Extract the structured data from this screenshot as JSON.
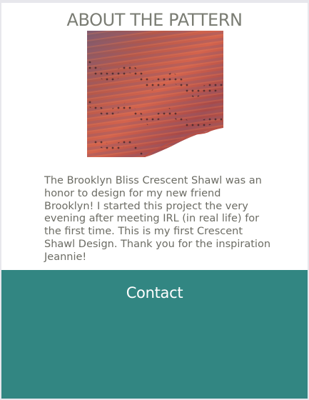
{
  "about": {
    "heading": "ABOUT THE PATTERN",
    "image_subject": "knitted lace crescent shawl in variegated orange, red and purple yarn",
    "description": "The Brooklyn Bliss Crescent Shawl was an honor to design for my new friend Brooklyn! I started this project the very evening after meeting IRL (in real life) for the first time. This is my first Crescent Shawl Design. Thank you for the inspiration Jeannie!"
  },
  "contact": {
    "title": "Contact"
  },
  "colors": {
    "page_bg": "#e7e7ec",
    "heading_text": "#7a7c73",
    "body_text": "#6c6c64",
    "contact_bg": "#328682",
    "contact_text": "#ffffff"
  }
}
